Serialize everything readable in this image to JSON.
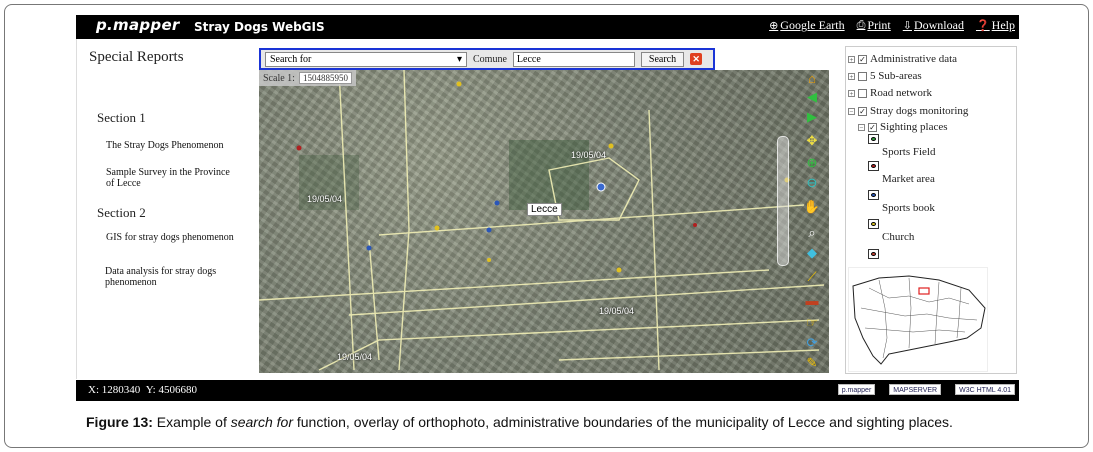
{
  "header": {
    "logo": "p.mapper",
    "title": "Stray Dogs WebGIS",
    "links": [
      {
        "label": "Google Earth",
        "icon": "globe-icon"
      },
      {
        "label": "Print",
        "icon": "printer-icon"
      },
      {
        "label": "Download",
        "icon": "download-icon"
      },
      {
        "label": "Help",
        "icon": "help-icon"
      }
    ]
  },
  "left_panel": {
    "title": "Special Reports",
    "sections": [
      {
        "heading": "Section 1",
        "links": [
          "The Stray Dogs Phenomenon",
          "Sample Survey in the Province of Lecce"
        ]
      },
      {
        "heading": "Section 2",
        "links": [
          "GIS for stray dogs phenomenon",
          "Data analysis for stray dogs phenomenon"
        ]
      }
    ]
  },
  "search": {
    "select_value": "Search for",
    "comune_label": "Comune",
    "comune_value": "Lecce",
    "button": "Search"
  },
  "map": {
    "scale_label": "Scale 1:",
    "scale_value": "1504885950",
    "place_label": "Lecce",
    "date_labels": [
      "19/05/04",
      "19/05/04",
      "19/05/04",
      "19/05/04"
    ]
  },
  "toc": {
    "items": [
      "Administrative data",
      "5 Sub-areas",
      "Road network",
      "Stray dogs monitoring",
      "Sighting places"
    ],
    "symbols": [
      {
        "label": "Sports Field",
        "color": "#2e9a3a"
      },
      {
        "label": "Market area",
        "color": "#b02020"
      },
      {
        "label": "Sports book",
        "color": "#2a56b8"
      },
      {
        "label": "Church",
        "color": "#d8c020"
      }
    ]
  },
  "status": {
    "x_label": "X:",
    "x_value": "1280340",
    "y_label": "Y:",
    "y_value": "4506680",
    "badges": [
      "p.mapper",
      "MAPSERVER",
      "W3C HTML 4.01"
    ]
  },
  "caption": {
    "label": "Figure 13:",
    "pre": "Example of",
    "italic": "search for",
    "post": "function, overlay of orthophoto, administrative boundaries of the municipality of Lecce and sighting places."
  }
}
